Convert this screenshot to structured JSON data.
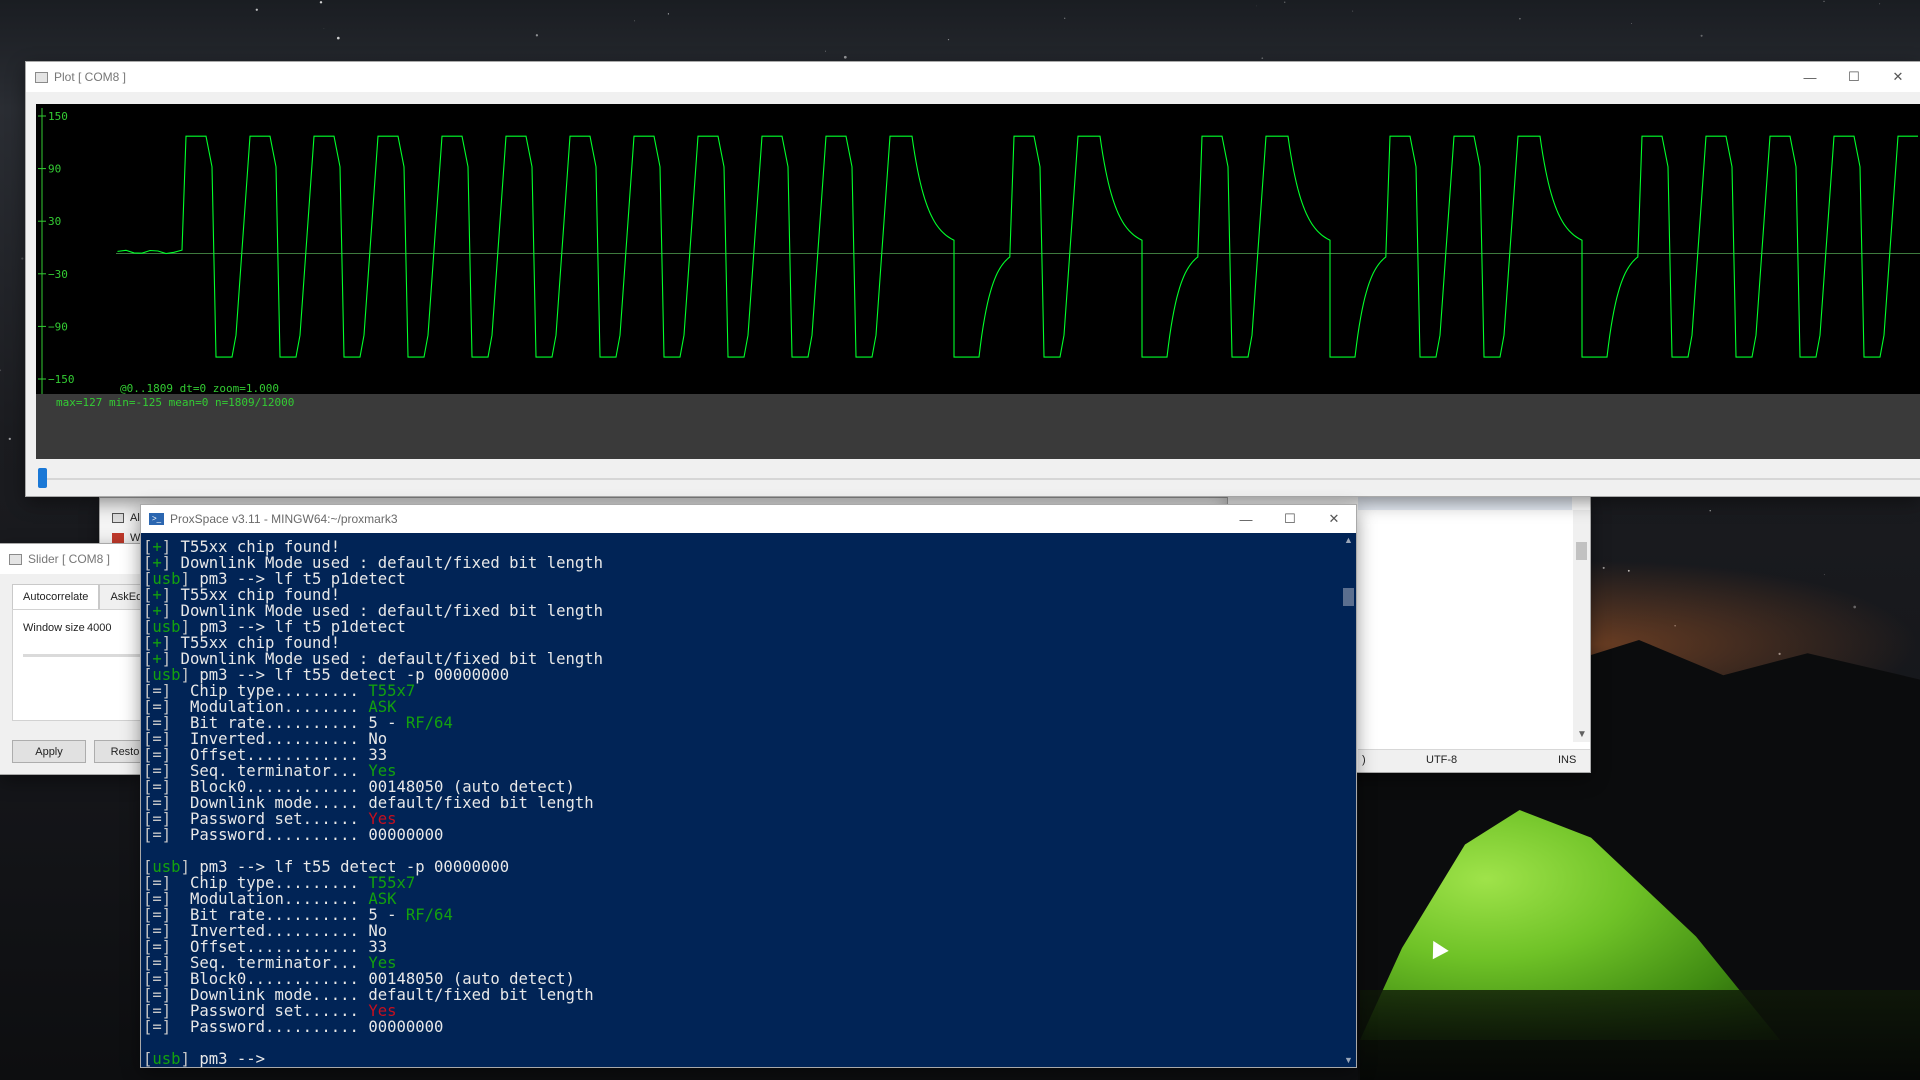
{
  "plot_window": {
    "title": "Plot [ COM8 ]",
    "info_line1": "@0..1809  dt=0  zoom=1.000",
    "info_line2": "max=127  min=-125  mean=0  n=1809/12000",
    "colors": {
      "background": "#000000",
      "trace": "#00ff2a",
      "axis": "#33cc33"
    }
  },
  "chart_data": {
    "type": "line",
    "yticks": [
      "150",
      "90",
      "30",
      "−30",
      "−90",
      "−150"
    ],
    "ylim": [
      -150,
      150
    ],
    "x_range": [
      0,
      1809
    ],
    "grid": false
  },
  "slider_window": {
    "title": "Slider [ COM8 ]",
    "tabs": [
      {
        "label": "Autocorrelate",
        "active": true
      },
      {
        "label": "AskEd",
        "active": false
      }
    ],
    "window_size_label": "Window size",
    "window_size_value": "4000",
    "apply_label": "Apply",
    "restore_label": "Resto"
  },
  "explorer": {
    "items": [
      {
        "label": "Al"
      },
      {
        "label": "W"
      }
    ]
  },
  "editor_window": {
    "status_left": ")",
    "encoding": "UTF-8",
    "mode": "INS"
  },
  "terminal": {
    "title": "ProxSpace v3.11 - MINGW64:~/proxmark3",
    "lines": [
      [
        [
          "b",
          "["
        ],
        [
          "p",
          "+"
        ],
        [
          "b",
          "]"
        ],
        [
          "w",
          " T55xx chip found!"
        ]
      ],
      [
        [
          "b",
          "["
        ],
        [
          "p",
          "+"
        ],
        [
          "b",
          "]"
        ],
        [
          "w",
          " Downlink Mode used : default/fixed bit length"
        ]
      ],
      [
        [
          "b",
          "["
        ],
        [
          "u",
          "usb"
        ],
        [
          "b",
          "]"
        ],
        [
          "w",
          " pm3 --> lf t5 p1detect"
        ]
      ],
      [
        [
          "b",
          "["
        ],
        [
          "p",
          "+"
        ],
        [
          "b",
          "]"
        ],
        [
          "w",
          " T55xx chip found!"
        ]
      ],
      [
        [
          "b",
          "["
        ],
        [
          "p",
          "+"
        ],
        [
          "b",
          "]"
        ],
        [
          "w",
          " Downlink Mode used : default/fixed bit length"
        ]
      ],
      [
        [
          "b",
          "["
        ],
        [
          "u",
          "usb"
        ],
        [
          "b",
          "]"
        ],
        [
          "w",
          " pm3 --> lf t5 p1detect"
        ]
      ],
      [
        [
          "b",
          "["
        ],
        [
          "p",
          "+"
        ],
        [
          "b",
          "]"
        ],
        [
          "w",
          " T55xx chip found!"
        ]
      ],
      [
        [
          "b",
          "["
        ],
        [
          "p",
          "+"
        ],
        [
          "b",
          "]"
        ],
        [
          "w",
          " Downlink Mode used : default/fixed bit length"
        ]
      ],
      [
        [
          "b",
          "["
        ],
        [
          "u",
          "usb"
        ],
        [
          "b",
          "]"
        ],
        [
          "w",
          " pm3 --> lf t55 detect -p 00000000"
        ]
      ],
      [
        [
          "b",
          "[=]"
        ],
        [
          "w",
          "  Chip type......... "
        ],
        [
          "g",
          "T55x7"
        ]
      ],
      [
        [
          "b",
          "[=]"
        ],
        [
          "w",
          "  Modulation........ "
        ],
        [
          "g",
          "ASK"
        ]
      ],
      [
        [
          "b",
          "[=]"
        ],
        [
          "w",
          "  Bit rate.......... 5 - "
        ],
        [
          "g",
          "RF/64"
        ]
      ],
      [
        [
          "b",
          "[=]"
        ],
        [
          "w",
          "  Inverted.......... No"
        ]
      ],
      [
        [
          "b",
          "[=]"
        ],
        [
          "w",
          "  Offset............ 33"
        ]
      ],
      [
        [
          "b",
          "[=]"
        ],
        [
          "w",
          "  Seq. terminator... "
        ],
        [
          "g",
          "Yes"
        ]
      ],
      [
        [
          "b",
          "[=]"
        ],
        [
          "w",
          "  Block0............ 00148050 (auto detect)"
        ]
      ],
      [
        [
          "b",
          "[=]"
        ],
        [
          "w",
          "  Downlink mode..... default/fixed bit length"
        ]
      ],
      [
        [
          "b",
          "[=]"
        ],
        [
          "w",
          "  Password set...... "
        ],
        [
          "r",
          "Yes"
        ]
      ],
      [
        [
          "b",
          "[=]"
        ],
        [
          "w",
          "  Password.......... 00000000"
        ]
      ],
      [],
      [
        [
          "b",
          "["
        ],
        [
          "u",
          "usb"
        ],
        [
          "b",
          "]"
        ],
        [
          "w",
          " pm3 --> lf t55 detect -p 00000000"
        ]
      ],
      [
        [
          "b",
          "[=]"
        ],
        [
          "w",
          "  Chip type......... "
        ],
        [
          "g",
          "T55x7"
        ]
      ],
      [
        [
          "b",
          "[=]"
        ],
        [
          "w",
          "  Modulation........ "
        ],
        [
          "g",
          "ASK"
        ]
      ],
      [
        [
          "b",
          "[=]"
        ],
        [
          "w",
          "  Bit rate.......... 5 - "
        ],
        [
          "g",
          "RF/64"
        ]
      ],
      [
        [
          "b",
          "[=]"
        ],
        [
          "w",
          "  Inverted.......... No"
        ]
      ],
      [
        [
          "b",
          "[=]"
        ],
        [
          "w",
          "  Offset............ 33"
        ]
      ],
      [
        [
          "b",
          "[=]"
        ],
        [
          "w",
          "  Seq. terminator... "
        ],
        [
          "g",
          "Yes"
        ]
      ],
      [
        [
          "b",
          "[=]"
        ],
        [
          "w",
          "  Block0............ 00148050 (auto detect)"
        ]
      ],
      [
        [
          "b",
          "[=]"
        ],
        [
          "w",
          "  Downlink mode..... default/fixed bit length"
        ]
      ],
      [
        [
          "b",
          "[=]"
        ],
        [
          "w",
          "  Password set...... "
        ],
        [
          "r",
          "Yes"
        ]
      ],
      [
        [
          "b",
          "[=]"
        ],
        [
          "w",
          "  Password.......... 00000000"
        ]
      ],
      [],
      [
        [
          "b",
          "["
        ],
        [
          "u",
          "usb"
        ],
        [
          "b",
          "]"
        ],
        [
          "w",
          " pm3 -->"
        ]
      ]
    ]
  },
  "window_controls": {
    "minimize": "—",
    "maximize": "☐",
    "close": "✕"
  }
}
